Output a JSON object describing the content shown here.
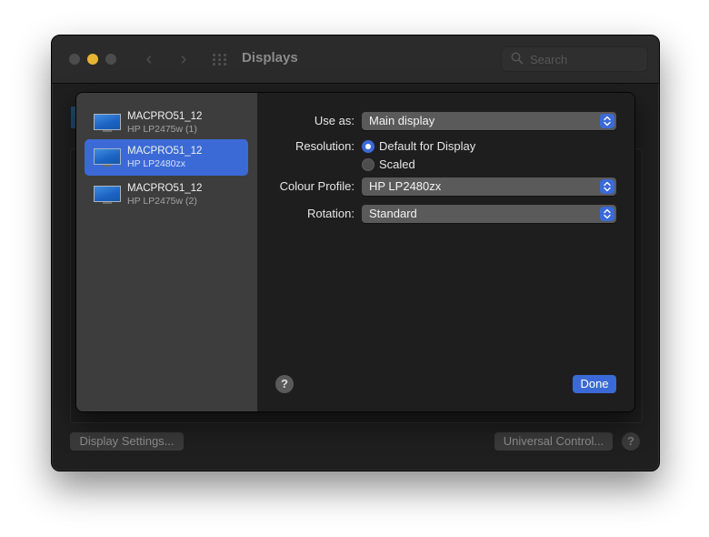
{
  "window": {
    "title": "Displays",
    "search": {
      "placeholder": "Search"
    }
  },
  "background": {
    "display_settings_button": "Display Settings...",
    "universal_control_button": "Universal Control...",
    "help": "?"
  },
  "sheet": {
    "displays": [
      {
        "name": "MACPRO51_12",
        "model": "HP LP2475w (1)",
        "selected": false
      },
      {
        "name": "MACPRO51_12",
        "model": "HP LP2480zx",
        "selected": true
      },
      {
        "name": "MACPRO51_12",
        "model": "HP LP2475w (2)",
        "selected": false
      }
    ],
    "use_as": {
      "label": "Use as:",
      "value": "Main display"
    },
    "resolution": {
      "label": "Resolution:",
      "options": [
        {
          "label": "Default for Display",
          "selected": true
        },
        {
          "label": "Scaled",
          "selected": false
        }
      ]
    },
    "colour_profile": {
      "label": "Colour Profile:",
      "value": "HP LP2480zx"
    },
    "rotation": {
      "label": "Rotation:",
      "value": "Standard"
    },
    "help": "?",
    "done_button": "Done"
  },
  "colors": {
    "accent": "#3b6ad7",
    "minimize": "#e6b534",
    "sidebar": "#3d3d3d",
    "content": "#1e1e1e"
  },
  "icons": [
    "search-icon",
    "monitor-icon",
    "chevron-left-icon",
    "chevron-right-icon",
    "grid-icon",
    "up-down-chevron-icon",
    "help-icon"
  ]
}
